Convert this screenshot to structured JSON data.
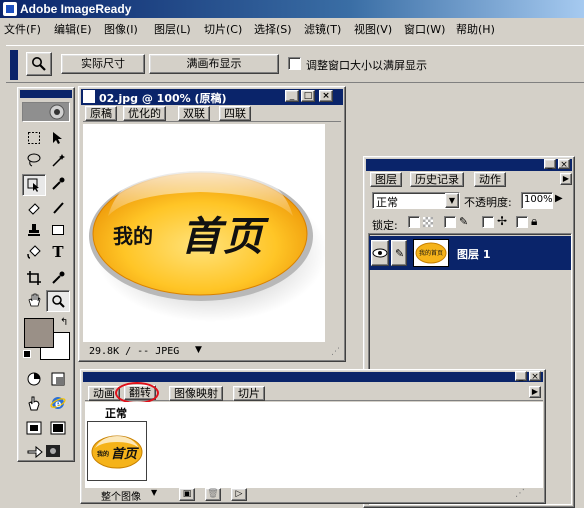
{
  "app": {
    "title": "Adobe ImageReady"
  },
  "menu": [
    "文件(F)",
    "编辑(E)",
    "图像(I)",
    "图层(L)",
    "切片(C)",
    "选择(S)",
    "滤镜(T)",
    "视图(V)",
    "窗口(W)",
    "帮助(H)"
  ],
  "options_bar": {
    "actual_pixels": "实际尺寸",
    "fit_on_screen": "满画布显示",
    "resize_windows_label": "调整窗口大小以满屏显示",
    "resize_windows_checked": false
  },
  "document": {
    "title": "02.jpg @ 100% (原稿)",
    "tabs": [
      "原稿",
      "优化的",
      "双联",
      "四联"
    ],
    "active_tab": "原稿",
    "image_text_small": "我的",
    "image_text_large": "首页",
    "status": "29.8K / -- JPEG",
    "colors": {
      "button_orange": "#f5a000",
      "button_light": "#ffe27a"
    }
  },
  "layers_panel": {
    "tabs": [
      "图层",
      "历史记录",
      "动作"
    ],
    "active_tab": "图层",
    "blend_mode": "正常",
    "opacity_label": "不透明度:",
    "opacity_value": "100%",
    "lock_label": "锁定:",
    "layers": [
      {
        "name": "图层 1",
        "thumb_text": "我的首页",
        "visible": true,
        "selected": true
      }
    ]
  },
  "rollover_panel": {
    "tabs": [
      "动画",
      "翻转",
      "图像映射",
      "切片"
    ],
    "active_tab": "翻转",
    "state_label": "正常",
    "thumb_text_small": "我的",
    "thumb_text_large": "首页",
    "footer_select": "整个图像",
    "highlight_color": "#e0101a"
  },
  "colors": {
    "titlebar": "#0a246a",
    "selection": "#0a246a",
    "chrome": "#d4d0c8",
    "fg_swatch": "#9a9087"
  }
}
